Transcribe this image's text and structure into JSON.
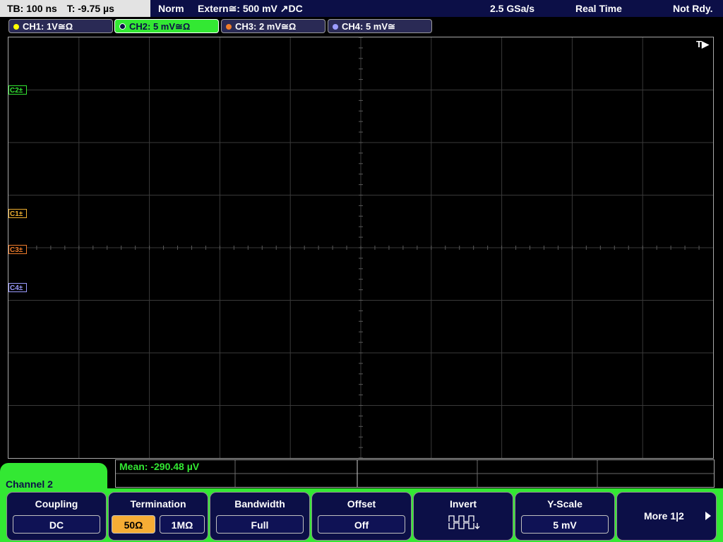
{
  "topbar": {
    "timebase": "TB: 100 ns",
    "trigger_time": "T: -9.75 µs",
    "mode": "Norm",
    "trigger": "Extern≅: 500 mV ↗DC",
    "sample_rate": "2.5 GSa/s",
    "acq_mode": "Real Time",
    "status": "Not Rdy."
  },
  "channels": [
    {
      "label": "CH1: 1V≅Ω",
      "color": "#ffff00"
    },
    {
      "label": "CH2: 5 mV≅Ω",
      "color": "#33e833"
    },
    {
      "label": "CH3: 2 mV≅Ω",
      "color": "#f07c2a"
    },
    {
      "label": "CH4: 5 mV≅",
      "color": "#9b9bff"
    }
  ],
  "grid": {
    "trigger_marker": "T▶",
    "markers": {
      "c2": "C2±",
      "c1": "C1±",
      "c3": "C3±",
      "c4": "C4±"
    }
  },
  "measurement": {
    "mean": "Mean: -290.48 µV"
  },
  "channel_panel": {
    "title": "Channel 2"
  },
  "softkeys": {
    "coupling": {
      "title": "Coupling",
      "value": "DC"
    },
    "termination": {
      "title": "Termination",
      "opt1": "50Ω",
      "opt2": "1MΩ"
    },
    "bandwidth": {
      "title": "Bandwidth",
      "value": "Full"
    },
    "offset": {
      "title": "Offset",
      "value": "Off"
    },
    "invert": {
      "title": "Invert",
      "icon": "invert-waveform-icon"
    },
    "yscale": {
      "title": "Y-Scale",
      "value": "5 mV"
    },
    "more": {
      "label": "More 1|2"
    }
  },
  "colors": {
    "ch1": "#ffff00",
    "ch2": "#33e833",
    "ch3": "#f07c2a",
    "ch4": "#9b9bff"
  }
}
